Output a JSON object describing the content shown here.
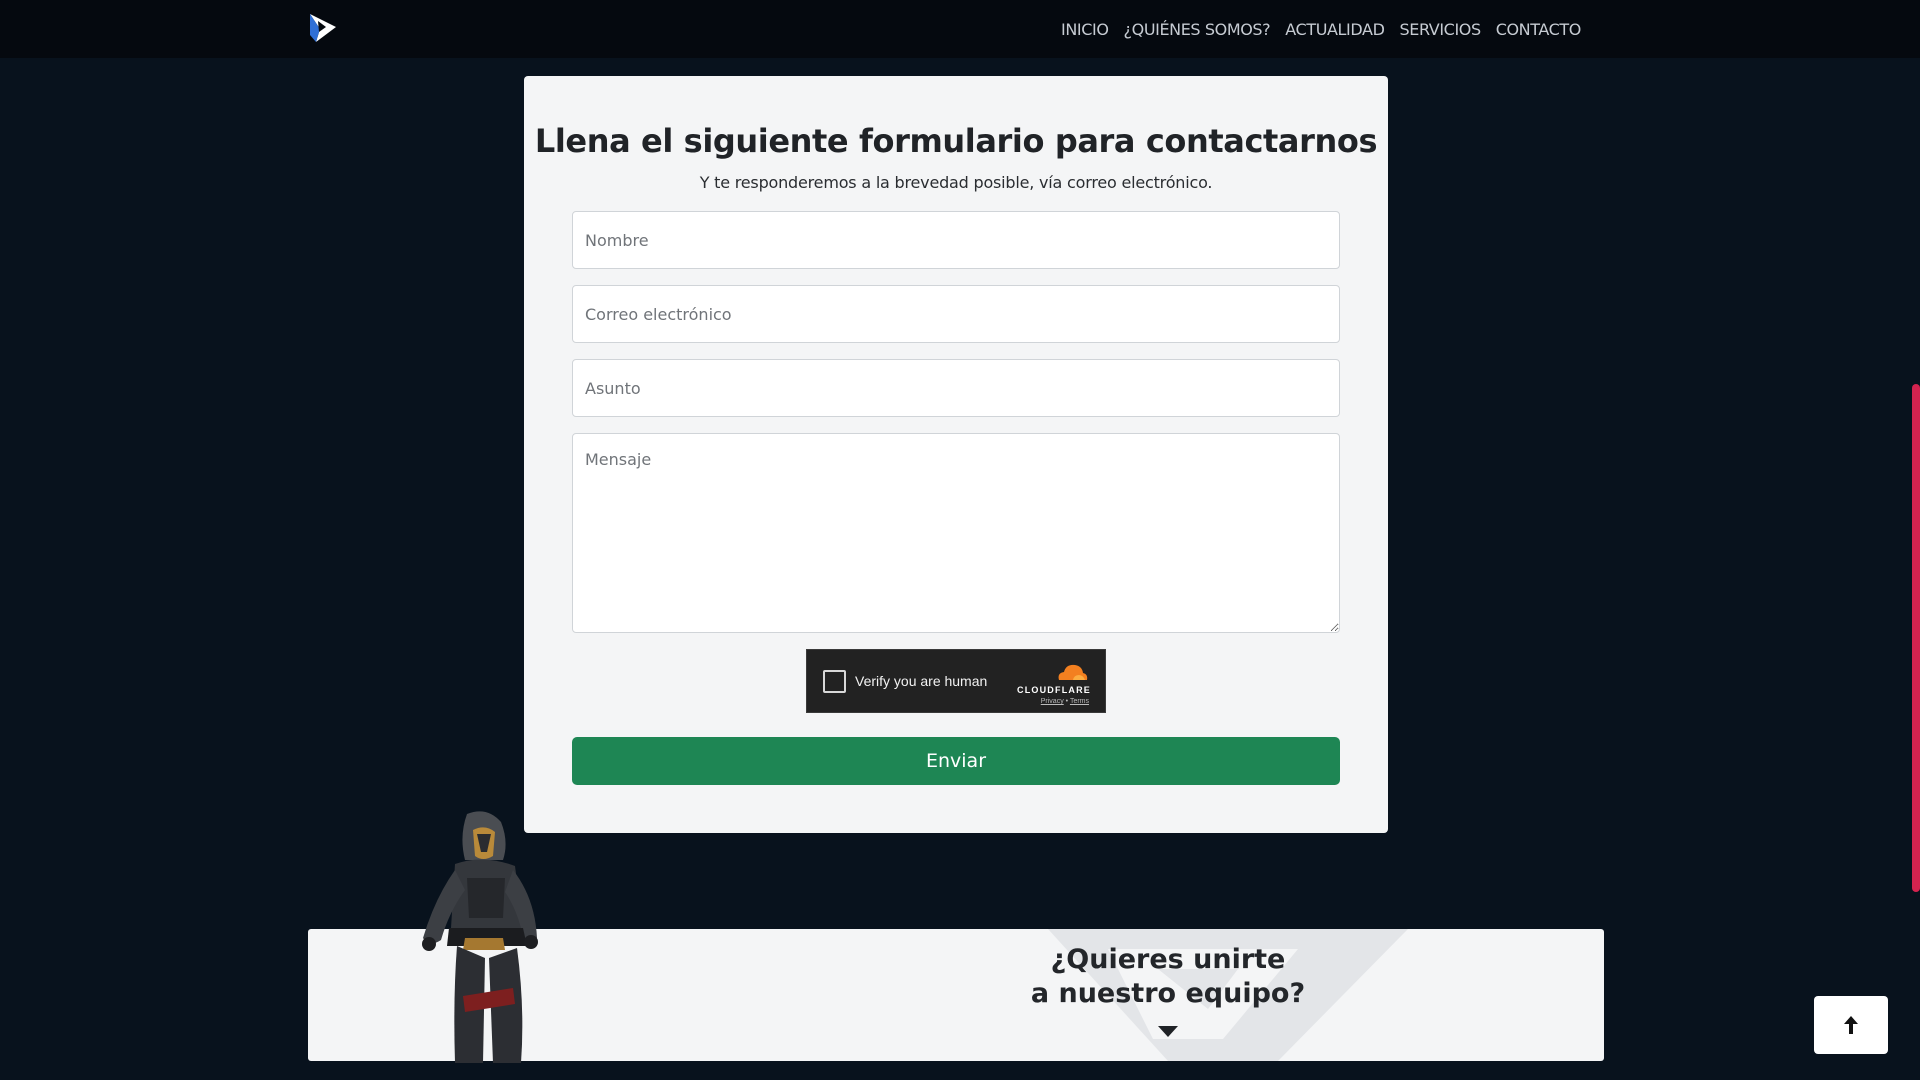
{
  "nav": {
    "links": [
      "INICIO",
      "¿QUIÉNES SOMOS?",
      "ACTUALIDAD",
      "SERVICIOS",
      "CONTACTO"
    ]
  },
  "form": {
    "title": "Llena el siguiente formulario para contactarnos",
    "subtitle": "Y te responderemos a la brevedad posible, vía correo electrónico.",
    "name_placeholder": "Nombre",
    "email_placeholder": "Correo electrónico",
    "subject_placeholder": "Asunto",
    "message_placeholder": "Mensaje",
    "submit_label": "Enviar"
  },
  "captcha": {
    "label": "Verify you are human",
    "brand": "CLOUDFLARE",
    "privacy": "Privacy",
    "separator": "•",
    "terms": "Terms",
    "checked": false
  },
  "join": {
    "title_line1": "¿Quieres unirte",
    "title_line2": "a nuestro equipo?"
  },
  "colors": {
    "page_background": "#08121d",
    "navbar": "#05090f",
    "submit_button": "#1e8654",
    "scrollbar_thumb": "#d4234f",
    "cloudflare_orange": "#f38020"
  },
  "icons": {
    "logo": "brand-logo",
    "back_to_top": "arrow-up-icon",
    "join_arrow": "caret-down-icon",
    "captcha_cloud": "cloudflare-cloud-icon"
  }
}
